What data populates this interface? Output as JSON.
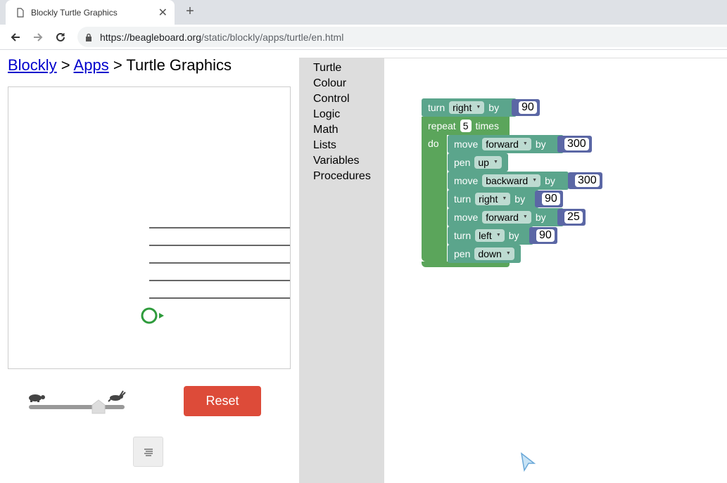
{
  "browser": {
    "tab_title": "Blockly Turtle Graphics",
    "url_main": "https://beagleboard.org",
    "url_path": "/static/blockly/apps/turtle/en.html"
  },
  "page": {
    "crumb_blockly": "Blockly",
    "sep1": " > ",
    "crumb_apps": "Apps",
    "sep2": " > ",
    "crumb_title": "Turtle Graphics",
    "reset_label": "Reset"
  },
  "toolbox": {
    "categories": [
      "Turtle",
      "Colour",
      "Control",
      "Logic",
      "Math",
      "Lists",
      "Variables",
      "Procedures"
    ]
  },
  "blocks": {
    "top_turn": {
      "kw": "turn",
      "dir": "right",
      "by": "by",
      "value": "90"
    },
    "repeat": {
      "kw": "repeat",
      "count": "5",
      "times": "times",
      "do": "do"
    },
    "body": [
      {
        "kw": "move",
        "opt": "forward",
        "by": "by",
        "value": "300"
      },
      {
        "kw": "pen",
        "opt": "up"
      },
      {
        "kw": "move",
        "opt": "backward",
        "by": "by",
        "value": "300"
      },
      {
        "kw": "turn",
        "opt": "right",
        "by": "by",
        "value": "90"
      },
      {
        "kw": "move",
        "opt": "forward",
        "by": "by",
        "value": "25"
      },
      {
        "kw": "turn",
        "opt": "left",
        "by": "by",
        "value": "90"
      },
      {
        "kw": "pen",
        "opt": "down"
      }
    ]
  },
  "colors": {
    "reset": "#dd4b39",
    "control_block": "#5ba55b",
    "turtle_block": "#5ba58c",
    "math_block": "#5b67a5",
    "toolbox_bg": "#dddddd",
    "turtle": "#2e9b3c"
  }
}
